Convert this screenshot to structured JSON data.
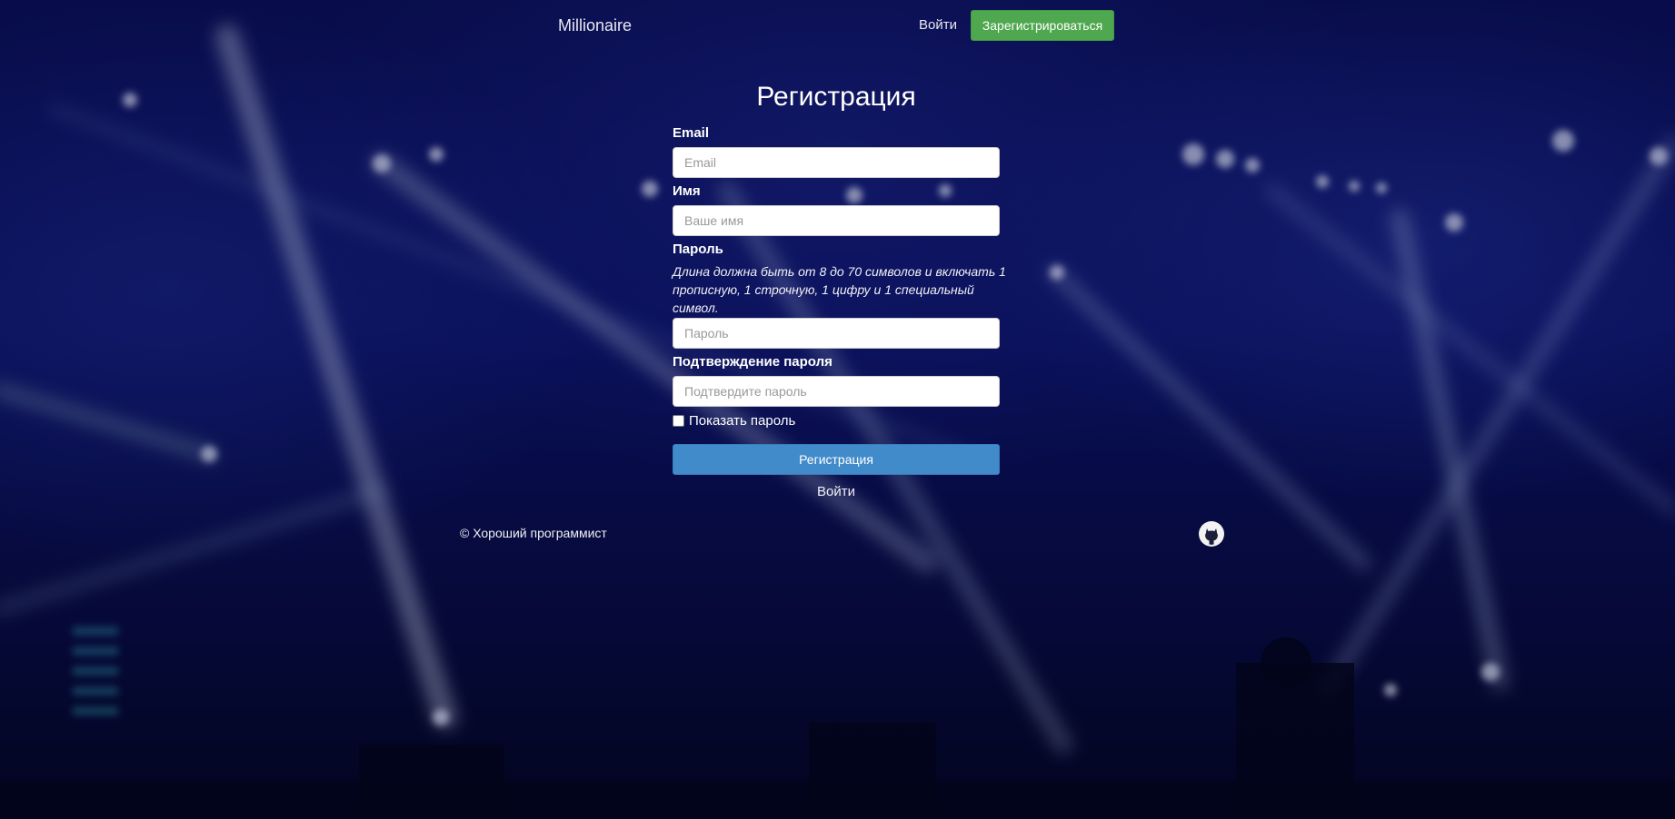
{
  "colors": {
    "accent_green": "#4fa84f",
    "accent_blue": "#428bca",
    "background": "#0b1163"
  },
  "navbar": {
    "brand": "Millionaire",
    "login_label": "Войти",
    "register_label": "Зарегистрироваться"
  },
  "form": {
    "title": "Регистрация",
    "email": {
      "label": "Email",
      "placeholder": "Email"
    },
    "name": {
      "label": "Имя",
      "placeholder": "Ваше имя"
    },
    "password": {
      "label": "Пароль",
      "hint": "Длина должна быть от 8 до 70 символов и включать 1 прописную, 1 строчную, 1 цифру и 1 специальный символ.",
      "placeholder": "Пароль"
    },
    "confirm": {
      "label": "Подтверждение пароля",
      "placeholder": "Подтвердите пароль"
    },
    "show_password_label": "Показать пароль",
    "show_password_checked": false,
    "submit_label": "Регистрация",
    "login_link": "Войти"
  },
  "footer": {
    "copyright": "© Хороший программист",
    "icon": "github-icon"
  }
}
